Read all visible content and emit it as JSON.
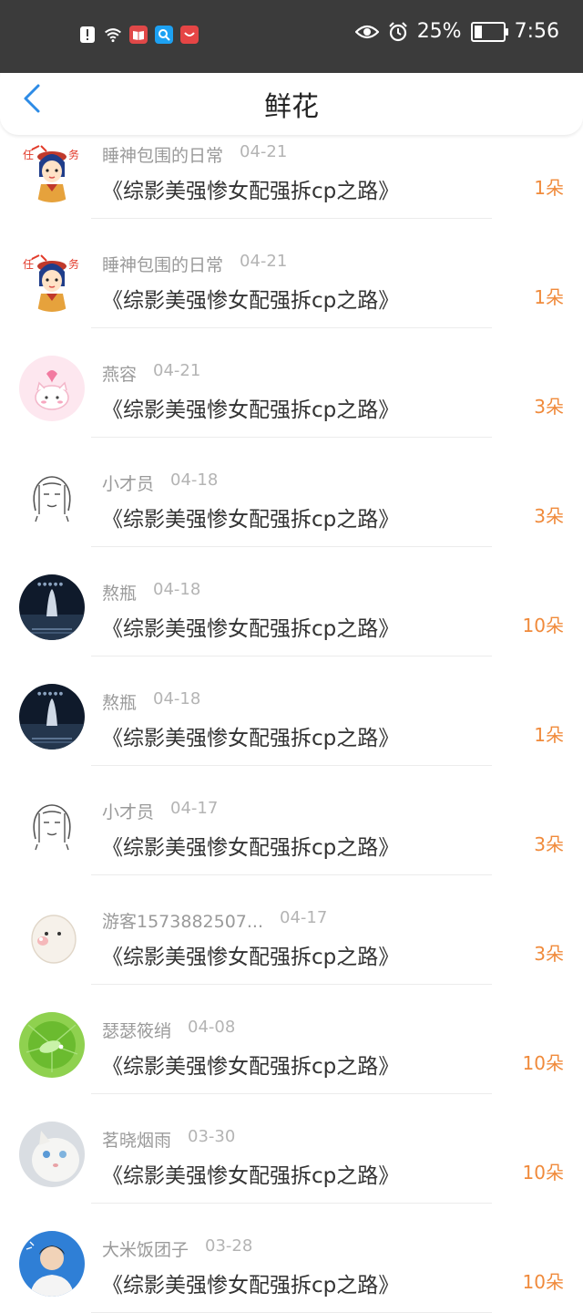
{
  "status_bar": {
    "battery_percent": "25%",
    "time": "7:56",
    "app_icons": [
      "notification-icon",
      "wifi-icon",
      "book-app-icon",
      "search-app-icon",
      "huawei-app-icon"
    ],
    "colors": {
      "book_app": "#e04848",
      "search_app": "#1da1f2",
      "huawei_app": "#e54545"
    }
  },
  "header": {
    "title": "鲜花"
  },
  "rows": [
    {
      "user": "睡神包围的日常",
      "date": "04-21",
      "book": "《综影美强惨女配强拆cp之路》",
      "amount": "1朵",
      "avatar": "cartoon-girl"
    },
    {
      "user": "睡神包围的日常",
      "date": "04-21",
      "book": "《综影美强惨女配强拆cp之路》",
      "amount": "1朵",
      "avatar": "cartoon-girl"
    },
    {
      "user": "燕容",
      "date": "04-21",
      "book": "《综影美强惨女配强拆cp之路》",
      "amount": "3朵",
      "avatar": "pink-cat"
    },
    {
      "user": "小才员",
      "date": "04-18",
      "book": "《综影美强惨女配强拆cp之路》",
      "amount": "3朵",
      "avatar": "sketch-face"
    },
    {
      "user": "熬瓶",
      "date": "04-18",
      "book": "《综影美强惨女配强拆cp之路》",
      "amount": "10朵",
      "avatar": "night-waterfall"
    },
    {
      "user": "熬瓶",
      "date": "04-18",
      "book": "《综影美强惨女配强拆cp之路》",
      "amount": "1朵",
      "avatar": "night-waterfall"
    },
    {
      "user": "小才员",
      "date": "04-17",
      "book": "《综影美强惨女配强拆cp之路》",
      "amount": "3朵",
      "avatar": "sketch-face"
    },
    {
      "user": "游客1573882507...",
      "date": "04-17",
      "book": "《综影美强惨女配强拆cp之路》",
      "amount": "3朵",
      "avatar": "white-ghost"
    },
    {
      "user": "瑟瑟筱绡",
      "date": "04-08",
      "book": "《综影美强惨女配强拆cp之路》",
      "amount": "10朵",
      "avatar": "green-leaf"
    },
    {
      "user": "茗晓烟雨",
      "date": "03-30",
      "book": "《综影美强惨女配强拆cp之路》",
      "amount": "10朵",
      "avatar": "white-cat"
    },
    {
      "user": "大米饭团子",
      "date": "03-28",
      "book": "《综影美强惨女配强拆cp之路》",
      "amount": "10朵",
      "avatar": "blue-portrait"
    }
  ]
}
